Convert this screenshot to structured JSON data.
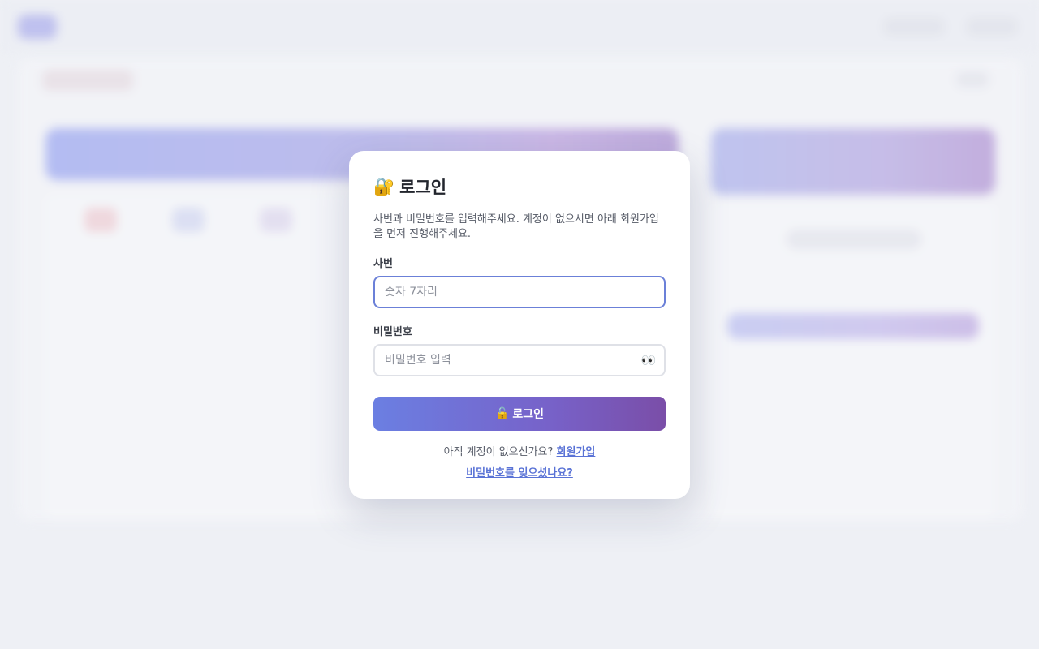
{
  "login": {
    "title": "로그인",
    "title_icon": "🔐",
    "description": "사번과 비밀번호를 입력해주세요. 계정이 없으시면 아래 회원가입을 먼저 진행해주세요.",
    "employee_id_label": "사번",
    "employee_id_placeholder": "숫자 7자리",
    "employee_id_value": "",
    "password_label": "비밀번호",
    "password_placeholder": "비밀번호 입력",
    "password_value": "",
    "password_toggle_icon": "👀",
    "submit_icon": "🔓",
    "submit_label": "로그인",
    "signup_prompt": "아직 계정이 없으신가요?",
    "signup_link": "회원가입",
    "forgot_link": "비밀번호를 잊으셨나요?"
  },
  "icons": {
    "title_icon_name": "lock-with-key-icon",
    "toggle_icon_name": "eyes-icon",
    "submit_icon_name": "unlocked-padlock-icon"
  },
  "colors": {
    "accent": "#6b80d8",
    "button_gradient_start": "#6b7fe2",
    "button_gradient_end": "#7a4ea8",
    "link": "#5a73d6"
  }
}
